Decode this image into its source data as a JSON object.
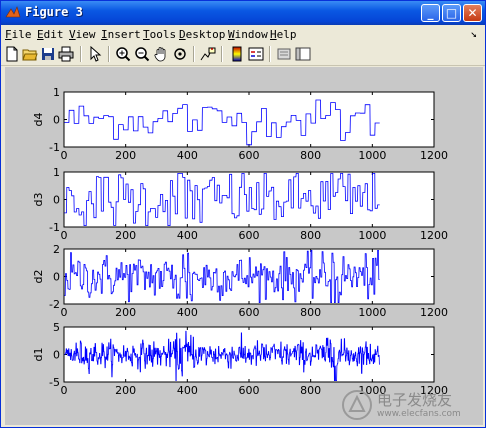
{
  "window": {
    "title": "Figure 3"
  },
  "menu": [
    "File",
    "Edit",
    "View",
    "Insert",
    "Tools",
    "Desktop",
    "Window",
    "Help"
  ],
  "toolbar_icons": [
    "new-file-icon",
    "open-folder-icon",
    "save-icon",
    "print-icon",
    "pointer-icon",
    "zoom-in-icon",
    "zoom-out-icon",
    "pan-hand-icon",
    "rotate-3d-icon",
    "data-cursor-icon",
    "colorbar-icon",
    "legend-icon",
    "hide-plot-tools-icon",
    "show-plot-tools-icon"
  ],
  "colors": {
    "line": "#0000ff",
    "axes_bg": "#ffffff",
    "figure_bg": "#c8c8c8"
  },
  "chart_data": [
    {
      "type": "line",
      "ylabel": "d4",
      "xlim": [
        0,
        1200
      ],
      "ylim": [
        -1,
        1
      ],
      "xticks": [
        "0",
        "200",
        "400",
        "600",
        "800",
        "1000",
        "1200"
      ],
      "yticks": [
        "-1",
        "0",
        "1"
      ],
      "n_points": 1024,
      "amplitude": 0.35,
      "block": 16,
      "series": [
        {
          "color": "#0000ff"
        }
      ]
    },
    {
      "type": "line",
      "ylabel": "d3",
      "xlim": [
        0,
        1200
      ],
      "ylim": [
        -1,
        1
      ],
      "xticks": [
        "0",
        "200",
        "400",
        "600",
        "800",
        "1000",
        "1200"
      ],
      "yticks": [
        "-1",
        "0",
        "1"
      ],
      "n_points": 1024,
      "amplitude": 0.55,
      "block": 8,
      "series": [
        {
          "color": "#0000ff"
        }
      ]
    },
    {
      "type": "line",
      "ylabel": "d2",
      "xlim": [
        0,
        1200
      ],
      "ylim": [
        -2,
        2
      ],
      "xticks": [
        "0",
        "200",
        "400",
        "600",
        "800",
        "1000",
        "1200"
      ],
      "yticks": [
        "-2",
        "0",
        "2"
      ],
      "n_points": 1024,
      "amplitude": 0.8,
      "block": 4,
      "series": [
        {
          "color": "#0000ff"
        }
      ]
    },
    {
      "type": "line",
      "ylabel": "d1",
      "xlim": [
        0,
        1200
      ],
      "ylim": [
        -5,
        5
      ],
      "xticks": [
        "0",
        "200",
        "400",
        "600",
        "800",
        "1000",
        "1200"
      ],
      "yticks": [
        "-5",
        "0",
        "5"
      ],
      "n_points": 1024,
      "amplitude": 1.2,
      "block": 2,
      "series": [
        {
          "color": "#0000ff"
        }
      ]
    }
  ],
  "watermark": {
    "text": "电子发烧友",
    "sub": "www.elecfans.com"
  }
}
